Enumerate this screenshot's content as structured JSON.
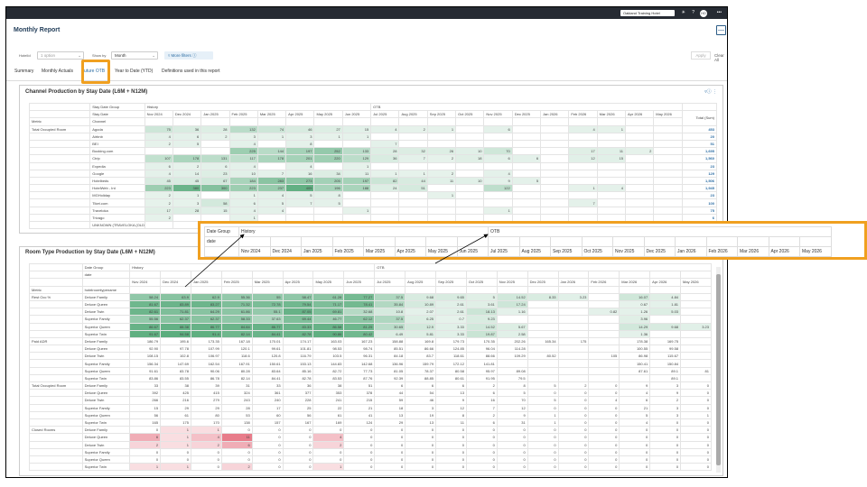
{
  "app": {
    "title": "Monthly Report",
    "hotel": "Oakland Training Hotel"
  },
  "filters": {
    "hotelid_label": "HotelId",
    "hotelid_value": "1 option",
    "showby_label": "Show by",
    "showby_value": "Month",
    "more_filters": "More filters",
    "apply": "Apply",
    "clear": "Clear All"
  },
  "tabs": [
    "Summary",
    "Monthly Actuals",
    "Future OTB",
    "Year to Date (YTD)",
    "Definitions used in this report"
  ],
  "colors": {
    "accent": "#2b6ca3",
    "highlight": "#f0a020",
    "topbar": "#262b33"
  },
  "months": [
    "Nov 2024",
    "Dec 2024",
    "Jan 2025",
    "Feb 2025",
    "Mar 2025",
    "Apr 2025",
    "May 2025",
    "Jun 2025",
    "Jul 2025",
    "Aug 2025",
    "Sep 2025",
    "Oct 2025",
    "Nov 2025",
    "Dec 2025",
    "Jan 2026",
    "Feb 2026",
    "Mar 2026",
    "Apr 2026",
    "May 2026"
  ],
  "panel1": {
    "title": "Channel Production by Stay Date (L6M + N12M)",
    "hdr_dategroup": "Stay Date Group",
    "hdr_date": "Stay Date",
    "hdr_history": "History",
    "hdr_otb": "OTB",
    "hdr_metric": "Metric",
    "hdr_channel": "Channel",
    "hdr_total": "Total (Sum)",
    "metric": "Total Occupied Room",
    "rows": [
      {
        "ch": "Agoda",
        "v": [
          "75",
          "36",
          "28",
          "132",
          "74",
          "46",
          "27",
          "15",
          "4",
          "2",
          "1",
          "",
          "6",
          "",
          "",
          "4",
          "1",
          "",
          ""
        ],
        "t": "453"
      },
      {
        "ch": "Airbnb",
        "v": [
          "4",
          "6",
          "2",
          "3",
          "1",
          "3",
          "1",
          "1",
          "",
          "",
          "",
          "",
          "",
          "",
          "",
          "",
          "",
          "",
          ""
        ],
        "t": "20"
      },
      {
        "ch": "BEI",
        "v": [
          "2",
          "5",
          "",
          "4",
          "",
          "8",
          "",
          "",
          "7",
          "",
          "",
          "",
          "",
          "",
          "",
          "",
          "",
          "",
          ""
        ],
        "t": "51"
      },
      {
        "ch": "Booking.com",
        "v": [
          "",
          "",
          "",
          "225",
          "144",
          "197",
          "252",
          "133",
          "28",
          "32",
          "26",
          "10",
          "70",
          "",
          "",
          "17",
          "11",
          "2",
          ""
        ],
        "t": "1,695"
      },
      {
        "ch": "Ctrip",
        "v": [
          "107",
          "178",
          "131",
          "117",
          "178",
          "201",
          "220",
          "129",
          "36",
          "7",
          "2",
          "18",
          "6",
          "6",
          "",
          "12",
          "15",
          "",
          ""
        ],
        "t": "1,560"
      },
      {
        "ch": "Expedia",
        "v": [
          "6",
          "2",
          "6",
          "4",
          "",
          "4",
          "",
          "1",
          "",
          "",
          "",
          "",
          "",
          "",
          "",
          "",
          "",
          "",
          ""
        ],
        "t": "23"
      },
      {
        "ch": "Google",
        "v": [
          "4",
          "14",
          "23",
          "10",
          "7",
          "16",
          "34",
          "11",
          "1",
          "1",
          "2",
          "",
          "4",
          "",
          "",
          "",
          "",
          "",
          ""
        ],
        "t": "129"
      },
      {
        "ch": "Hotelbeds",
        "v": [
          "45",
          "45",
          "67",
          "184",
          "283",
          "273",
          "205",
          "197",
          "82",
          "44",
          "11",
          "10",
          "9",
          "5",
          "",
          "",
          "",
          "",
          ""
        ],
        "t": "1,506"
      },
      {
        "ch": "HotelWeb - Int",
        "v": [
          "223",
          "380",
          "300",
          "223",
          "237",
          "405",
          "196",
          "188",
          "24",
          "51",
          "",
          "",
          "122",
          "",
          "",
          "1",
          "4",
          "",
          ""
        ],
        "t": "1,945"
      },
      {
        "ch": "MGHoliday",
        "v": [
          "2",
          "1",
          "",
          "1",
          "4",
          "5",
          "8",
          "",
          "",
          "",
          "1",
          "",
          "",
          "",
          "",
          "",
          "",
          "",
          ""
        ],
        "t": "23"
      },
      {
        "ch": "Tiket.com",
        "v": [
          "2",
          "3",
          "58",
          "6",
          "5",
          "7",
          "5",
          "",
          "",
          "",
          "",
          "",
          "",
          "",
          "",
          "7",
          "",
          "",
          ""
        ],
        "t": "100"
      },
      {
        "ch": "Traveloka",
        "v": [
          "17",
          "28",
          "15",
          "4",
          "4",
          "",
          "",
          "1",
          "",
          "",
          "",
          "",
          "1",
          "",
          "",
          "",
          "",
          "",
          ""
        ],
        "t": "75"
      },
      {
        "ch": "Trivago",
        "v": [
          "2",
          "",
          "",
          "1",
          "",
          "",
          "",
          "",
          "",
          "",
          "",
          "",
          "",
          "",
          "",
          "",
          "",
          "",
          ""
        ],
        "t": "6"
      },
      {
        "ch": "UNKNOWN (TRAVELOKA (OLD))",
        "v": [
          "",
          "",
          "",
          "",
          "",
          "",
          "",
          "",
          "",
          "",
          "",
          "",
          "",
          "",
          "",
          "",
          "",
          "",
          ""
        ],
        "t": ""
      }
    ]
  },
  "zoom": {
    "date_group": "Date Group",
    "history": "History",
    "otb": "OTB",
    "date": "date"
  },
  "panel2": {
    "title": "Room Type Production by Stay Date (L6M + N12M)",
    "hdr_dategroup": "Date Group",
    "hdr_date": "date",
    "hdr_history": "History",
    "hdr_otb": "OTB",
    "hdr_metric": "Metric",
    "hdr_roomtype": "hotelroomtypename",
    "groups": [
      {
        "metric": "Rest Occ %",
        "rows": [
          {
            "rt": "Deluxe Family",
            "v": [
              "58.24",
              "63.9",
              "62.9",
              "55.36",
              "55",
              "58.47",
              "61.28",
              "77.27",
              "37.5",
              "9.68",
              "9.65",
              "5",
              "14.52",
              "8.33",
              "3.23",
              "",
              "16.07",
              "4.84",
              ""
            ]
          },
          {
            "rt": "Deluxe Queen",
            "v": [
              "81.67",
              "83.89",
              "83.27",
              "71.32",
              "72.78",
              "79.54",
              "71.17",
              "78.41",
              "35.84",
              "10.89",
              "2.61",
              "3.61",
              "17.24",
              "",
              "",
              "",
              "0.67",
              "1.81",
              ""
            ]
          },
          {
            "rt": "Deluxe Twin",
            "v": [
              "82.61",
              "71.81",
              "64.29",
              "61.86",
              "55.1",
              "87.05",
              "69.81",
              "32.68",
              "10.8",
              "2.07",
              "2.61",
              "18.13",
              "1.16",
              "",
              "",
              "0.82",
              "1.26",
              "5.03",
              ""
            ]
          },
          {
            "rt": "Superior Family",
            "v": [
              "55.56",
              "62.37",
              "62.37",
              "58.33",
              "37.63",
              "69.44",
              "46.77",
              "62.12",
              "37.5",
              "6.25",
              "0.7",
              "9.23",
              "",
              "",
              "",
              "",
              "3.96",
              "",
              ""
            ]
          },
          {
            "rt": "Superior Queen",
            "v": [
              "86.67",
              "88.38",
              "86.77",
              "84.84",
              "86.77",
              "83.33",
              "86.58",
              "81.25",
              "30.65",
              "12.9",
              "3.33",
              "14.52",
              "5.67",
              "",
              "",
              "",
              "14.29",
              "9.68",
              "3.23"
            ]
          },
          {
            "rt": "Superior Twin",
            "v": [
              "91.67",
              "94.58",
              "91.4",
              "82.14",
              "84.41",
              "82.78",
              "90.86",
              "80.42",
              "6.49",
              "5.81",
              "3.33",
              "19.87",
              "2.58",
              "",
              "",
              "",
              "1.36",
              "",
              ""
            ]
          }
        ]
      },
      {
        "metric": "Paid ADR",
        "rows": [
          {
            "rt": "Deluxe Family",
            "v": [
              "186.79",
              "195.6",
              "173.35",
              "167.18",
              "170.01",
              "174.17",
              "163.03",
              "167.23",
              "158.88",
              "169.8",
              "179.73",
              "170.35",
              "202.26",
              "165.34",
              "175",
              "",
              "178.38",
              "169.75",
              ""
            ]
          },
          {
            "rt": "Deluxe Queen",
            "v": [
              "92.90",
              "97.78",
              "107.99",
              "120.1",
              "99.61",
              "101.81",
              "98.53",
              "98.74",
              "85.51",
              "86.66",
              "124.85",
              "96.04",
              "114.28",
              "",
              "",
              "",
              "100.55",
              "99.58",
              ""
            ]
          },
          {
            "rt": "Deluxe Twin",
            "v": [
              "108.15",
              "102.8",
              "106.97",
              "118.6",
              "120.8",
              "116.79",
              "103.5",
              "96.31",
              "84.18",
              "83.7",
              "118.61",
              "88.66",
              "109.29",
              "80.52",
              "",
              "105",
              "86.98",
              "115.67",
              ""
            ]
          },
          {
            "rt": "Superior Family",
            "v": [
              "156.34",
              "147.69",
              "162.54",
              "167.91",
              "150.61",
              "153.13",
              "144.83",
              "142.68",
              "136.96",
              "159.79",
              "172.12",
              "141.81",
              "",
              "",
              "",
              "",
              "150.41",
              "150.84",
              ""
            ]
          },
          {
            "rt": "Superior Queen",
            "v": [
              "91.61",
              "83.78",
              "90.06",
              "80.28",
              "83.64",
              "85.16",
              "82.72",
              "77.73",
              "81.05",
              "78.37",
              "80.58",
              "95.97",
              "89.08",
              "",
              "",
              "",
              "87.61",
              "89.1",
              "81"
            ]
          },
          {
            "rt": "Superior Twin",
            "v": [
              "83.86",
              "83.55",
              "86.78",
              "82.14",
              "84.41",
              "82.78",
              "83.53",
              "87.76",
              "92.39",
              "88.85",
              "80.61",
              "91.95",
              "79.5",
              "",
              "",
              "",
              "",
              "89.1",
              ""
            ]
          }
        ]
      },
      {
        "metric": "Total Occupied Room",
        "rows": [
          {
            "rt": "Deluxe Family",
            "v": [
              "33",
              "38",
              "39",
              "31",
              "33",
              "36",
              "38",
              "51",
              "6",
              "6",
              "6",
              "2",
              "8",
              "5",
              "2",
              "0",
              "9",
              "3",
              "0"
            ]
          },
          {
            "rt": "Deluxe Queen",
            "v": [
              "392",
              "425",
              "415",
              "324",
              "361",
              "377",
              "353",
              "378",
              "44",
              "54",
              "13",
              "6",
              "5",
              "0",
              "0",
              "0",
              "4",
              "9",
              "0"
            ]
          },
          {
            "rt": "Deluxe Twin",
            "v": [
              "266",
              "216",
              "279",
              "243",
              "240",
              "228",
              "241",
              "215",
              "59",
              "46",
              "9",
              "16",
              "70",
              "5",
              "0",
              "4",
              "6",
              "2",
              "0"
            ]
          },
          {
            "rt": "Superior Family",
            "v": [
              "15",
              "29",
              "29",
              "28",
              "17",
              "25",
              "22",
              "21",
              "18",
              "3",
              "12",
              "7",
              "12",
              "0",
              "0",
              "0",
              "21",
              "3",
              "0"
            ]
          },
          {
            "rt": "Superior Queen",
            "v": [
              "56",
              "61",
              "80",
              "53",
              "60",
              "56",
              "61",
              "41",
              "13",
              "19",
              "8",
              "2",
              "9",
              "1",
              "0",
              "0",
              "5",
              "3",
              "1"
            ]
          },
          {
            "rt": "Superior Twin",
            "v": [
              "165",
              "175",
              "170",
              "138",
              "157",
              "167",
              "169",
              "124",
              "29",
              "13",
              "11",
              "6",
              "31",
              "1",
              "0",
              "0",
              "4",
              "0",
              "0"
            ]
          }
        ]
      },
      {
        "metric": "Closed Rooms",
        "rows": [
          {
            "rt": "Deluxe Family",
            "v": [
              "0",
              "1",
              "1",
              "0",
              "0",
              "0",
              "0",
              "0",
              "0",
              "0",
              "0",
              "0",
              "0",
              "0",
              "0",
              "0",
              "0",
              "0",
              "0"
            ]
          },
          {
            "rt": "Deluxe Queen",
            "v": [
              "6",
              "1",
              "4",
              "11",
              "0",
              "0",
              "4",
              "0",
              "0",
              "0",
              "0",
              "0",
              "0",
              "0",
              "0",
              "0",
              "0",
              "0",
              "0"
            ]
          },
          {
            "rt": "Deluxe Twin",
            "v": [
              "2",
              "1",
              "2",
              "6",
              "0",
              "0",
              "2",
              "0",
              "0",
              "0",
              "0",
              "0",
              "0",
              "0",
              "0",
              "0",
              "0",
              "0",
              "0"
            ]
          },
          {
            "rt": "Superior Family",
            "v": [
              "0",
              "0",
              "0",
              "0",
              "0",
              "0",
              "0",
              "0",
              "0",
              "0",
              "0",
              "0",
              "0",
              "0",
              "0",
              "0",
              "0",
              "0",
              "0"
            ]
          },
          {
            "rt": "Superior Queen",
            "v": [
              "0",
              "0",
              "0",
              "0",
              "0",
              "0",
              "0",
              "0",
              "0",
              "0",
              "0",
              "0",
              "0",
              "0",
              "0",
              "0",
              "0",
              "0",
              "0"
            ]
          },
          {
            "rt": "Superior Twin",
            "v": [
              "1",
              "1",
              "0",
              "2",
              "0",
              "0",
              "1",
              "0",
              "0",
              "0",
              "0",
              "0",
              "0",
              "0",
              "0",
              "0",
              "0",
              "0",
              "0"
            ]
          }
        ]
      }
    ]
  }
}
